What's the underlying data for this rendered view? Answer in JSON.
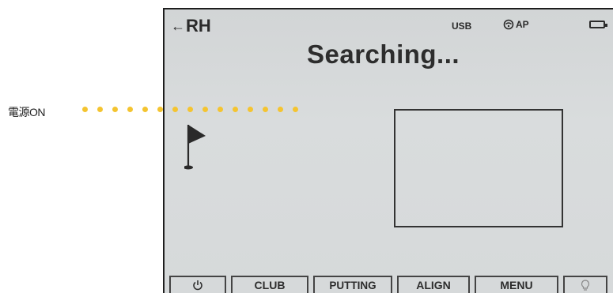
{
  "annotation": {
    "label": "電源ON",
    "dot_color": "#f4c430",
    "dot_count": 15
  },
  "header": {
    "hand": "RH",
    "usb": "USB",
    "network": "AP",
    "icons": [
      "back-arrow-icon",
      "wifi-icon",
      "battery-icon"
    ]
  },
  "status": "Searching...",
  "toolbar": {
    "buttons": [
      {
        "icon": "power-icon"
      },
      {
        "label": "CLUB"
      },
      {
        "label": "PUTTING"
      },
      {
        "label": "ALIGN"
      },
      {
        "label": "MENU"
      },
      {
        "icon": "lightbulb-icon"
      }
    ]
  }
}
